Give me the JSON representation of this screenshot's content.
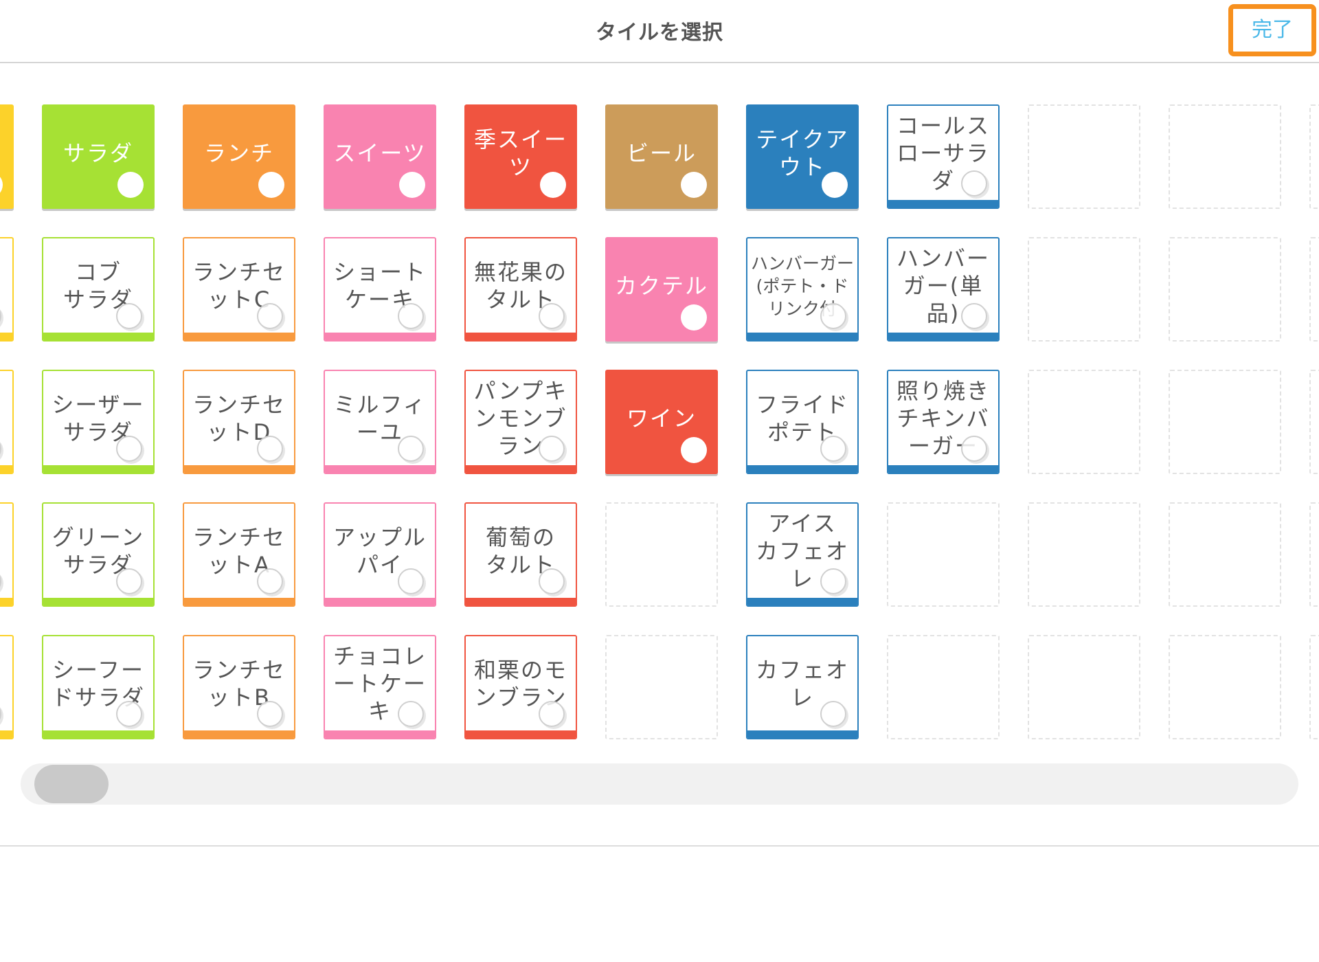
{
  "header": {
    "title": "タイルを選択",
    "done_label": "完了"
  },
  "colors": {
    "yellow": "#fcd22a",
    "green": "#a6e134",
    "orange": "#f89a3e",
    "pink": "#f983b0",
    "red": "#f05440",
    "tan": "#cc9c5a",
    "blue": "#2b80bd",
    "focus_outline": "#f7901e",
    "done_text": "#4ab8e8"
  },
  "grid": {
    "columns": [
      {
        "color": "yellow",
        "cells": [
          {
            "kind": "filled",
            "label": ""
          },
          {
            "kind": "outlined",
            "label": ""
          },
          {
            "kind": "outlined",
            "label": ""
          },
          {
            "kind": "outlined",
            "label": ""
          },
          {
            "kind": "outlined",
            "label": ""
          }
        ]
      },
      {
        "color": "green",
        "cells": [
          {
            "kind": "filled",
            "label": "サラダ"
          },
          {
            "kind": "outlined",
            "label": "コブ\nサラダ"
          },
          {
            "kind": "outlined",
            "label": "シーザー\nサラダ"
          },
          {
            "kind": "outlined",
            "label": "グリーン\nサラダ"
          },
          {
            "kind": "outlined",
            "label": "シーフー\nドサラダ"
          }
        ]
      },
      {
        "color": "orange",
        "cells": [
          {
            "kind": "filled",
            "label": "ランチ"
          },
          {
            "kind": "outlined",
            "label": "ランチセ\nットC"
          },
          {
            "kind": "outlined",
            "label": "ランチセ\nットD"
          },
          {
            "kind": "outlined",
            "label": "ランチセ\nットA"
          },
          {
            "kind": "outlined",
            "label": "ランチセ\nットB"
          }
        ]
      },
      {
        "color": "pink",
        "cells": [
          {
            "kind": "filled",
            "label": "スイーツ"
          },
          {
            "kind": "outlined",
            "label": "ショート\nケーキ"
          },
          {
            "kind": "outlined",
            "label": "ミルフィ\nーユ"
          },
          {
            "kind": "outlined",
            "label": "アップル\nパイ"
          },
          {
            "kind": "outlined",
            "label": "チョコレ\nートケー\nキ"
          }
        ]
      },
      {
        "color": "red",
        "cells": [
          {
            "kind": "filled",
            "label": "季スイー\nツ"
          },
          {
            "kind": "outlined",
            "label": "無花果の\nタルト"
          },
          {
            "kind": "outlined",
            "label": "パンプキ\nンモンブ\nラン"
          },
          {
            "kind": "outlined",
            "label": "葡萄の\nタルト"
          },
          {
            "kind": "outlined",
            "label": "和栗のモ\nンブラン"
          }
        ]
      },
      {
        "color": "tan",
        "cells": [
          {
            "kind": "filled",
            "label": "ビール"
          },
          {
            "kind": "filled",
            "label": "カクテル",
            "color": "pink"
          },
          {
            "kind": "filled",
            "label": "ワイン",
            "color": "red"
          },
          {
            "kind": "empty"
          },
          {
            "kind": "empty"
          }
        ]
      },
      {
        "color": "blue",
        "cells": [
          {
            "kind": "filled",
            "label": "テイクア\nウト"
          },
          {
            "kind": "outlined",
            "label": "ハンバーガー\n(ポテト・ド\nリンク付",
            "small": true
          },
          {
            "kind": "outlined",
            "label": "フライド\nポテト"
          },
          {
            "kind": "outlined",
            "label": "アイス\nカフェオ\nレ"
          },
          {
            "kind": "outlined",
            "label": "カフェオ\nレ"
          }
        ]
      },
      {
        "color": "blue",
        "cells": [
          {
            "kind": "outlined",
            "label": "コールス\nローサラ\nダ"
          },
          {
            "kind": "outlined",
            "label": "ハンバー\nガー(単品)"
          },
          {
            "kind": "outlined",
            "label": "照り焼き\nチキンバ\nーガー"
          },
          {
            "kind": "empty"
          },
          {
            "kind": "empty"
          }
        ]
      },
      {
        "cells": [
          {
            "kind": "empty"
          },
          {
            "kind": "empty"
          },
          {
            "kind": "empty"
          },
          {
            "kind": "empty"
          },
          {
            "kind": "empty"
          }
        ]
      },
      {
        "cells": [
          {
            "kind": "empty"
          },
          {
            "kind": "empty"
          },
          {
            "kind": "empty"
          },
          {
            "kind": "empty"
          },
          {
            "kind": "empty"
          }
        ]
      },
      {
        "cells": [
          {
            "kind": "empty"
          },
          {
            "kind": "empty"
          },
          {
            "kind": "empty"
          },
          {
            "kind": "empty"
          },
          {
            "kind": "empty"
          }
        ]
      }
    ]
  },
  "scrollbar": {
    "position": 0
  }
}
